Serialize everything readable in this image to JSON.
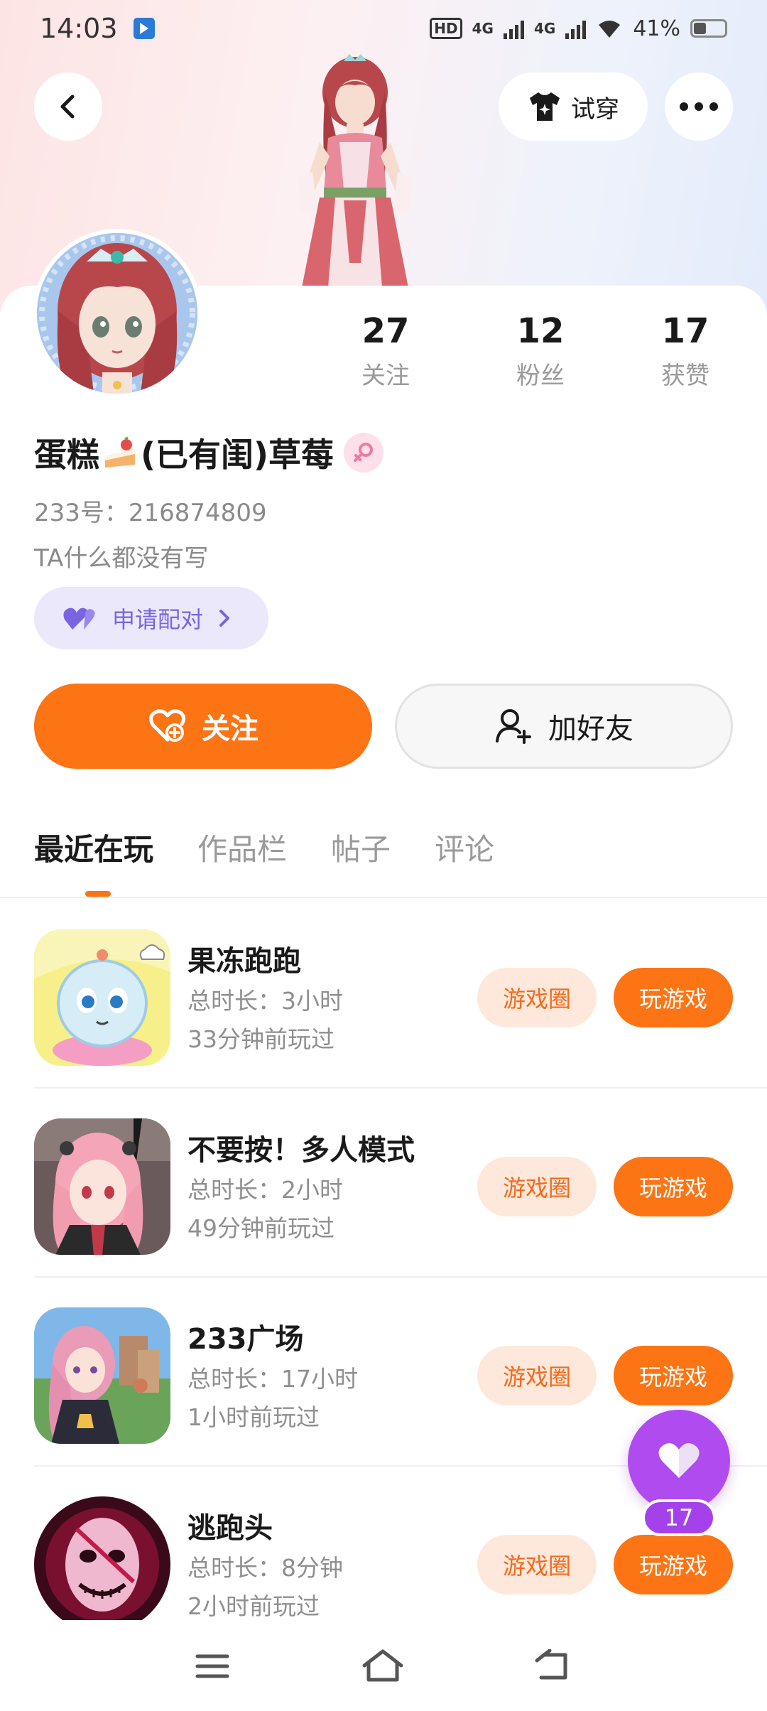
{
  "status_bar": {
    "time": "14:03",
    "hd": "HD",
    "network1": "4G",
    "network2": "4G",
    "battery": "41%",
    "battery_level": 0.41
  },
  "header": {
    "tryon_label": "试穿"
  },
  "profile": {
    "name_part1": "蛋糕",
    "name_part2": "(已有闺)草莓",
    "uid": "233号：216874809",
    "bio": "TA什么都没有写",
    "pair_label": "申请配对",
    "stats": [
      {
        "value": "27",
        "label": "关注"
      },
      {
        "value": "12",
        "label": "粉丝"
      },
      {
        "value": "17",
        "label": "获赞"
      }
    ]
  },
  "actions": {
    "follow_label": "关注",
    "add_friend_label": "加好友"
  },
  "tabs": [
    {
      "label": "最近在玩",
      "active": true
    },
    {
      "label": "作品栏",
      "active": false
    },
    {
      "label": "帖子",
      "active": false
    },
    {
      "label": "评论",
      "active": false
    }
  ],
  "games": [
    {
      "name": "果冻跑跑",
      "duration": "总时长：3小时",
      "last_played": "33分钟前玩过",
      "circle_label": "游戏圈",
      "play_label": "玩游戏"
    },
    {
      "name": "不要按！多人模式",
      "duration": "总时长：2小时",
      "last_played": "49分钟前玩过",
      "circle_label": "游戏圈",
      "play_label": "玩游戏"
    },
    {
      "name": "233广场",
      "duration": "总时长：17小时",
      "last_played": "1小时前玩过",
      "circle_label": "游戏圈",
      "play_label": "玩游戏"
    },
    {
      "name": "逃跑头",
      "duration": "总时长：8分钟",
      "last_played": "2小时前玩过",
      "circle_label": "游戏圈",
      "play_label": "玩游戏"
    }
  ],
  "floating_like": {
    "count": "17"
  },
  "colors": {
    "accent": "#fd7414",
    "like_purple": "#b04bf0",
    "pair_purple": "#7a64e0"
  }
}
